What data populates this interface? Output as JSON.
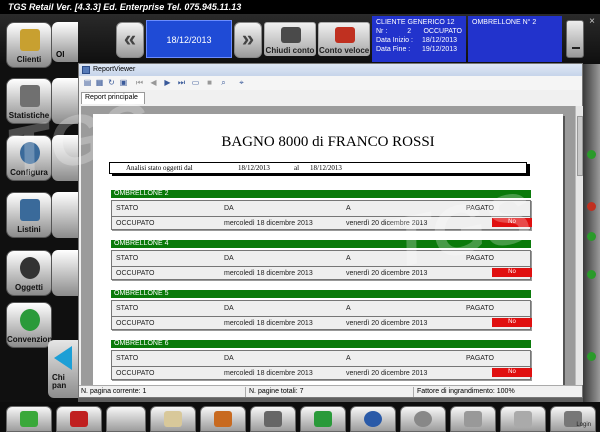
{
  "app": {
    "title": "TGS Retail Ver. [4.3.3] Ed. Enterprise    Tel. 075.945.11.13"
  },
  "header": {
    "date": "18/12/2013",
    "chiudi_conto": "Chiudi conto",
    "conto_veloce": "Conto veloce",
    "cliente": {
      "name": "CLIENTE GENERICO 12",
      "nr_label": "Nr :",
      "nr_value": "2",
      "status": "OCCUPATO",
      "data_inizio_label": "Data Inizio :",
      "data_inizio": "18/12/2013",
      "data_fine_label": "Data Fine :",
      "data_fine": "19/12/2013"
    },
    "ombrellone": "OMBRELLONE N° 2",
    "close_label": "×"
  },
  "sidebar": {
    "items": [
      {
        "label": "Clienti",
        "color": "#c8a030"
      },
      {
        "label": "Statistiche",
        "color": "#707070"
      },
      {
        "label": "Configura",
        "color": "#3a6a9a"
      },
      {
        "label": "Listini",
        "color": "#3a6a9a"
      },
      {
        "label": "Oggetti",
        "color": "#333333"
      },
      {
        "label": "Convenzioni",
        "color": "#2a9a3a"
      }
    ],
    "second_col_label": "Ol",
    "chip_label": "Chi pan"
  },
  "report_viewer": {
    "window_title": "ReportViewer",
    "tab": "Report principale",
    "title": "BAGNO 8000 di FRANCO ROSSI",
    "subheader": {
      "label": "Analisi stato oggetti dal",
      "from": "18/12/2013",
      "al": "al",
      "to": "18/12/2013"
    },
    "columns": {
      "stato": "STATO",
      "da": "DA",
      "a": "A",
      "pagato": "PAGATO"
    },
    "groups": [
      {
        "name": "OMBRELLONE 2",
        "stato": "OCCUPATO",
        "da": "mercoledì 18 dicembre 2013",
        "a": "venerdì 20 dicembre 2013",
        "pagato": "No"
      },
      {
        "name": "OMBRELLONE 4",
        "stato": "OCCUPATO",
        "da": "mercoledì 18 dicembre 2013",
        "a": "venerdì 20 dicembre 2013",
        "pagato": "No"
      },
      {
        "name": "OMBRELLONE 5",
        "stato": "OCCUPATO",
        "da": "mercoledì 18 dicembre 2013",
        "a": "venerdì 20 dicembre 2013",
        "pagato": "No"
      },
      {
        "name": "OMBRELLONE 6",
        "stato": "OCCUPATO",
        "da": "mercoledì 18 dicembre 2013",
        "a": "venerdì 20 dicembre 2013",
        "pagato": "No"
      }
    ],
    "status": {
      "current_page": "N. pagina corrente: 1",
      "total_pages": "N. pagine totali: 7",
      "zoom": "Fattore di ingrandimento: 100%"
    }
  },
  "watermark": "TGS",
  "bottom": {
    "login_label": "Login"
  },
  "colors": {
    "group_header": "#0a7a0a",
    "badge": "#e01010",
    "info_panel": "#2233cc",
    "date_box": "#1f4bd6"
  }
}
